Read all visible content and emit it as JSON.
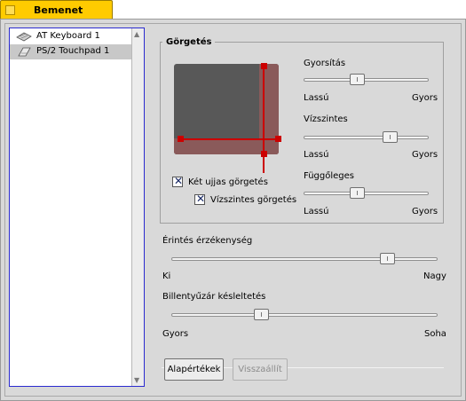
{
  "tab": {
    "label": "Bemenet"
  },
  "devices": [
    {
      "label": "AT Keyboard 1",
      "icon": "keyboard-icon",
      "selected": false
    },
    {
      "label": "PS/2 Touchpad 1",
      "icon": "touchpad-icon",
      "selected": true
    }
  ],
  "scrolling": {
    "title": "Görgetés",
    "two_finger": {
      "label": "Két ujjas görgetés",
      "checked": true
    },
    "horizontal_two_finger": {
      "label": "Vízszintes görgetés",
      "checked": true
    },
    "speed": {
      "label": "Gyorsítás",
      "min": "Lassú",
      "max": "Gyors",
      "value": 0.42
    },
    "horizontal": {
      "label": "Vízszintes",
      "min": "Lassú",
      "max": "Gyors",
      "value": 0.72
    },
    "vertical": {
      "label": "Függőleges",
      "min": "Lassú",
      "max": "Gyors",
      "value": 0.42
    }
  },
  "sensitivity": {
    "label": "Érintés érzékenység",
    "min": "Ki",
    "max": "Nagy",
    "value": 0.83
  },
  "typing_delay": {
    "label": "Billentyűzár késleltetés",
    "min": "Gyors",
    "max": "Soha",
    "value": 0.33
  },
  "buttons": {
    "defaults": "Alapértékek",
    "revert": "Visszaállít"
  },
  "colors": {
    "tab": "#ffcb00",
    "selection_border": "#2b2bd0",
    "pad_marker": "#cc0000"
  }
}
